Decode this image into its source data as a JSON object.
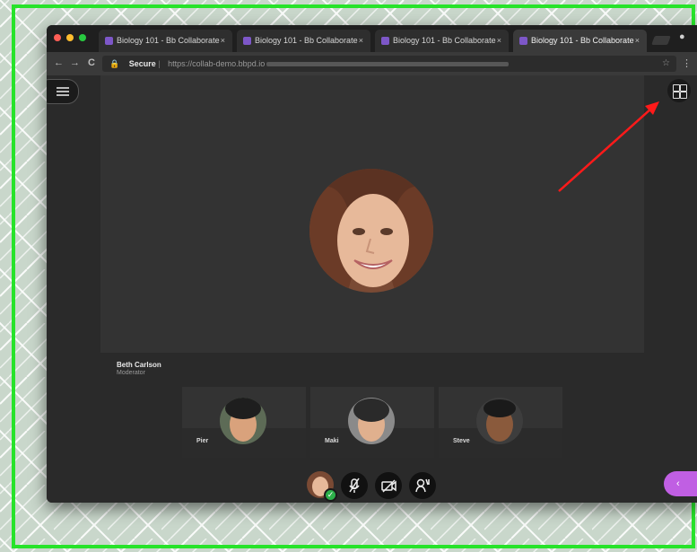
{
  "colors": {
    "frame_accent": "#27e32a",
    "collaborate_panel": "#c05fe3",
    "favicon": "#7d57c8",
    "annotation_arrow": "#ff1a1a",
    "status_ok": "#2db04a"
  },
  "browser": {
    "tabs": [
      {
        "label": "Biology 101 - Bb Collaborate",
        "close": "×"
      },
      {
        "label": "Biology 101 - Bb Collaborate",
        "close": "×"
      },
      {
        "label": "Biology 101 - Bb Collaborate",
        "close": "×"
      },
      {
        "label": "Biology 101 - Bb Collaborate",
        "close": "×"
      }
    ],
    "nav": {
      "back": "←",
      "forward": "→",
      "reload": "C"
    },
    "address": {
      "secure_label": "Secure",
      "url": "https://collab-demo.bbpd.io"
    },
    "icons": {
      "lock": "lock-icon",
      "star": "star-icon",
      "menu": "kebab-menu-icon",
      "profile": "profile-icon"
    }
  },
  "session": {
    "menu_icon": "hamburger-menu-icon",
    "layout_toggle_icon": "grid-view-icon",
    "active_speaker": {
      "name": "Beth Carlson",
      "role": "Moderator"
    },
    "participants": [
      {
        "name": "Pier"
      },
      {
        "name": "Maki"
      },
      {
        "name": "Steve"
      }
    ],
    "controls": {
      "status_icon": "check-icon",
      "mic_icon": "microphone-off-icon",
      "camera_icon": "camera-off-icon",
      "hand_icon": "raise-hand-icon"
    },
    "collaborate_panel_icon": "collaborate-panel-icon"
  }
}
